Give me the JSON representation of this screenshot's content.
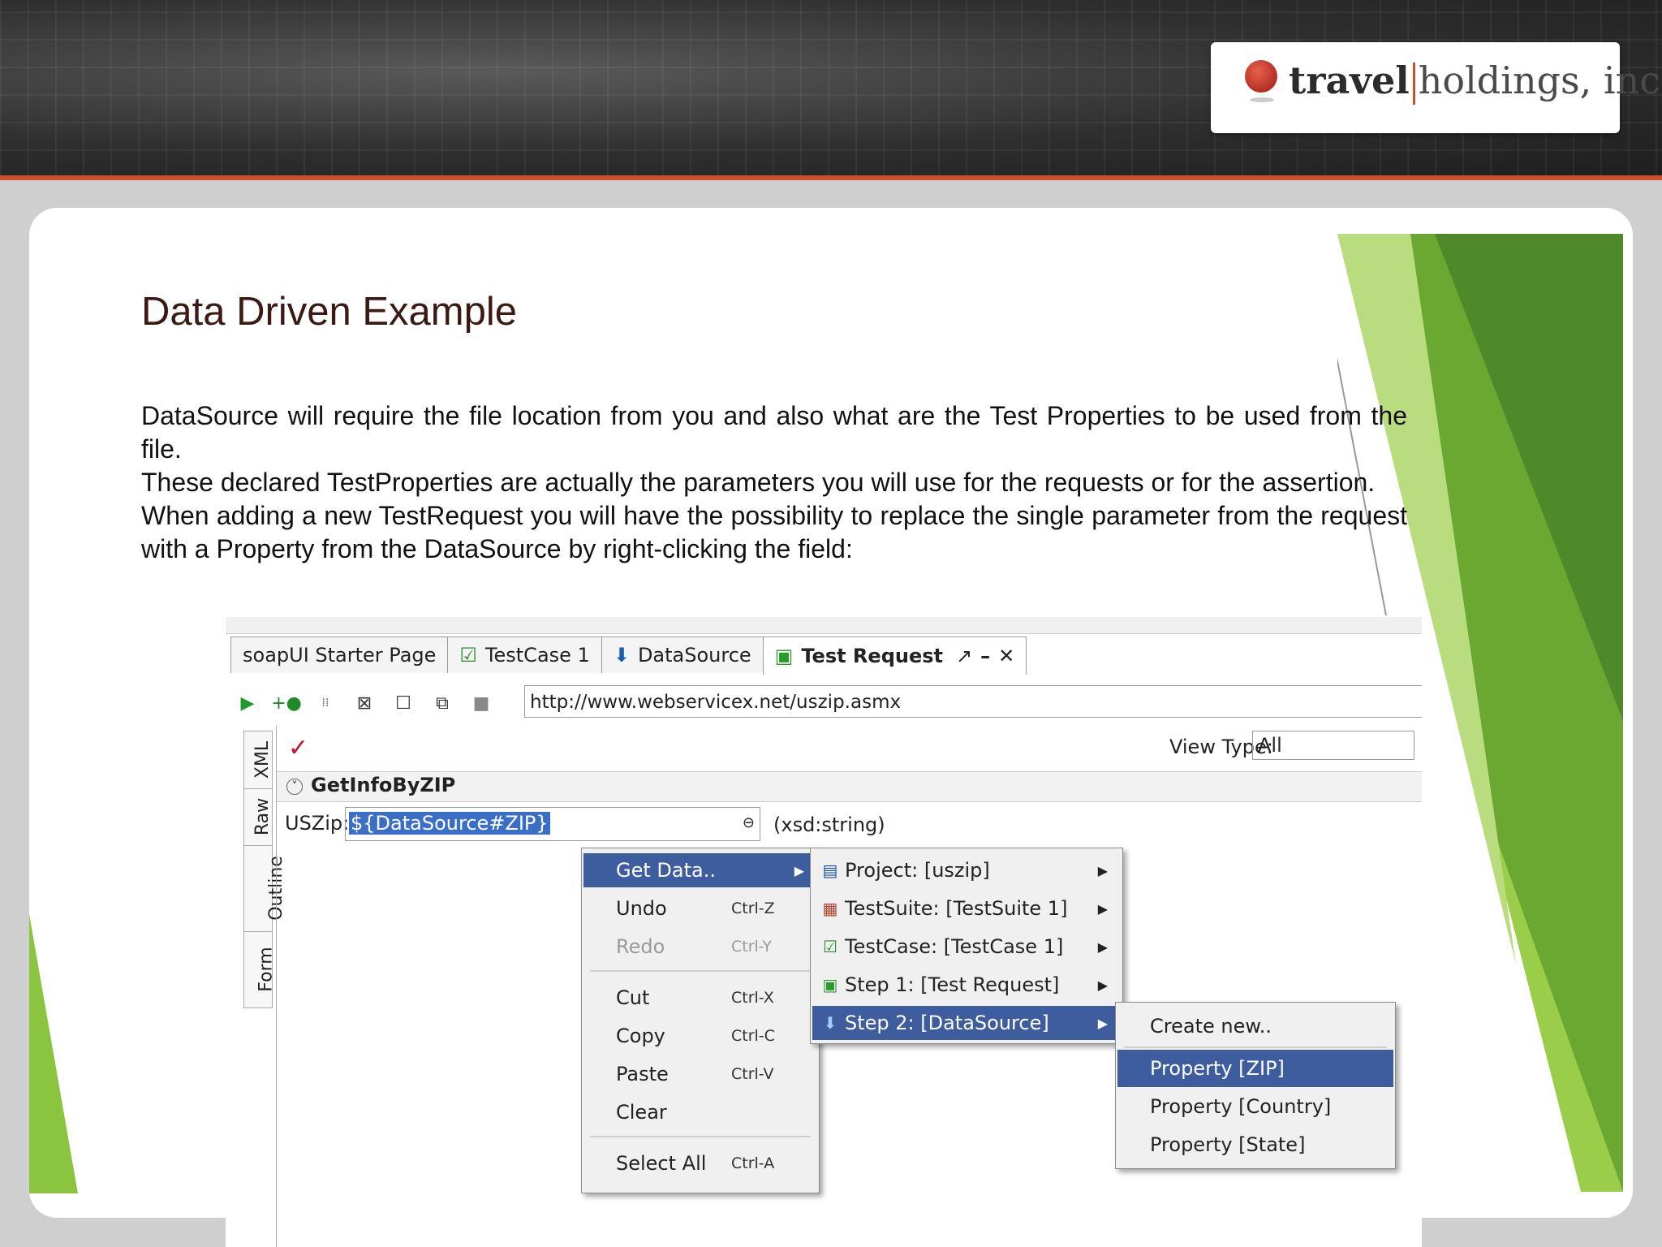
{
  "banner": {
    "logo_bold": "travel",
    "logo_light": "holdings, inc."
  },
  "slide": {
    "title": "Data Driven Example",
    "paragraphs": [
      "DataSource will require the file location from you and also what are the Test Properties to be used from the file.",
      "These declared TestProperties are actually the parameters you will use for the requests or for the assertion.",
      "When adding a new TestRequest you will have the possibility to replace the single parameter from the request with a Property from the DataSource by right-clicking the field:"
    ]
  },
  "app": {
    "tabs": [
      "soapUI Starter Page",
      "TestCase 1",
      "DataSource",
      "Test Request"
    ],
    "url": "http://www.webservicex.net/uszip.asmx",
    "view_type_label": "View Type:",
    "view_type_value": "All",
    "side_tabs": [
      "XML",
      "Raw",
      "Outline",
      "Form"
    ],
    "operation": "GetInfoByZIP",
    "field_label": "USZip:",
    "field_value": "${DataSource#ZIP}",
    "field_type": "(xsd:string)"
  },
  "context_menu": {
    "items": [
      {
        "label": "Get Data..",
        "shortcut": ""
      },
      {
        "label": "Undo",
        "shortcut": "Ctrl-Z"
      },
      {
        "label": "Redo",
        "shortcut": "Ctrl-Y"
      },
      {
        "label": "Cut",
        "shortcut": "Ctrl-X"
      },
      {
        "label": "Copy",
        "shortcut": "Ctrl-C"
      },
      {
        "label": "Paste",
        "shortcut": "Ctrl-V"
      },
      {
        "label": "Clear",
        "shortcut": ""
      },
      {
        "label": "Select All",
        "shortcut": "Ctrl-A"
      }
    ]
  },
  "submenu": {
    "items": [
      "Project: [uszip]",
      "TestSuite: [TestSuite 1]",
      "TestCase: [TestCase 1]",
      "Step 1: [Test Request]",
      "Step 2: [DataSource]"
    ]
  },
  "submenu2": {
    "items": [
      "Create new..",
      "Property [ZIP]",
      "Property [Country]",
      "Property [State]"
    ]
  },
  "colors": {
    "accent_orange": "#c8502a",
    "highlight_blue": "#3d5d9e",
    "green": "#6aa832"
  },
  "icons": {
    "logo": "globe-icon",
    "toolbar": [
      "run-icon",
      "add-assertion-icon",
      "soap-icon",
      "fit-icon",
      "square-icon",
      "copy-icon",
      "stop-icon"
    ],
    "menu": [
      "project-icon",
      "testsuite-icon",
      "testcase-icon",
      "soap-step-icon",
      "datasource-icon"
    ]
  }
}
